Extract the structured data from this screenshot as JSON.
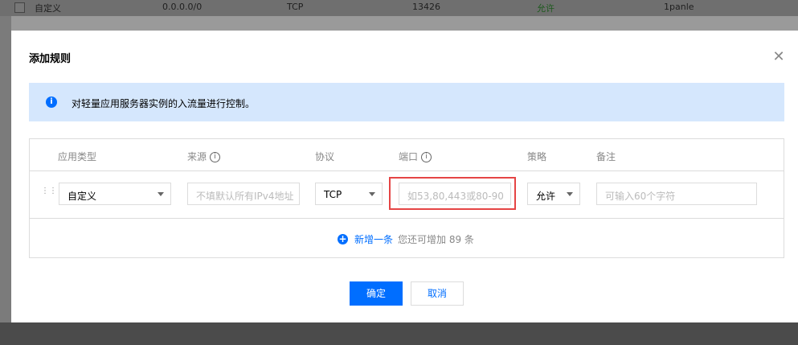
{
  "background_row": {
    "type": "自定义",
    "source": "0.0.0.0/0",
    "protocol": "TCP",
    "port": "13426",
    "policy": "允许",
    "note": "1panle"
  },
  "dialog": {
    "title": "添加规则",
    "close_icon": "close-icon",
    "notice_text": "对轻量应用服务器实例的入流量进行控制。",
    "headers": {
      "type": "应用类型",
      "source": "来源",
      "protocol": "协议",
      "port": "端口",
      "policy": "策略",
      "note": "备注"
    },
    "row": {
      "type_value": "自定义",
      "source_placeholder": "不填默认所有IPv4地址",
      "protocol_value": "TCP",
      "port_placeholder": "如53,80,443或80-90",
      "policy_value": "允许",
      "note_placeholder": "可输入60个字符"
    },
    "add_link": "新增一条",
    "remaining_text": "您还可增加 89 条",
    "ok_label": "确定",
    "cancel_label": "取消"
  },
  "colors": {
    "accent": "#006eff",
    "notice_bg": "#d5e7fd",
    "highlight": "#e54545"
  }
}
